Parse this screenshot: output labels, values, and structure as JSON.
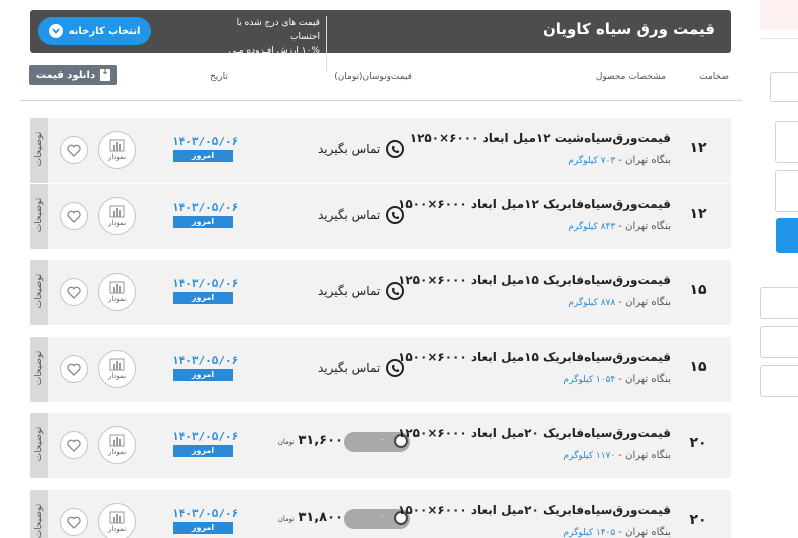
{
  "header": {
    "title": "قیمت ورق سیاه کاویان",
    "note_line1": "قیمت های درج شده با احتساب",
    "note_line2": "۱۰% ارزش افـزوده مـی بـاشـد.",
    "factory_button": "انتخاب کارخانه"
  },
  "table_header": {
    "thickness": "ضخامت",
    "specs": "مشخصات محصول",
    "price": "قیمت‌ونوسان(تومان)",
    "date": "تاریخ",
    "download_button": "دانلود قیمت"
  },
  "labels": {
    "description": "توضیحات",
    "chart": "نمودار",
    "today": "امروز",
    "contact": "تماس بگیرید",
    "currency": "تومان",
    "change_zero": "۰"
  },
  "rows": [
    {
      "thickness": "۱۲",
      "name": "قیمت‌ورق‌سیاه‌شیت ۱۲میل ابعاد ۶۰۰۰×۱۲۵۰",
      "warehouse": "بنگاه تهران - ",
      "weight": "۷۰۳ کیلوگرم",
      "date": "۱۴۰۳/۰۵/۰۶",
      "price": null
    },
    {
      "thickness": "۱۲",
      "name": "قیمت‌ورق‌سیاه‌فابریک ۱۲میل ابعاد ۶۰۰۰×۱۵۰۰",
      "warehouse": "بنگاه تهران - ",
      "weight": "۸۴۳ کیلوگرم",
      "date": "۱۴۰۳/۰۵/۰۶",
      "price": null
    },
    {
      "thickness": "۱۵",
      "name": "قیمت‌ورق‌سیاه‌فابریک ۱۵میل ابعاد ۶۰۰۰×۱۲۵۰",
      "warehouse": "بنگاه تهران - ",
      "weight": "۸۷۸ کیلوگرم",
      "date": "۱۴۰۳/۰۵/۰۶",
      "price": null
    },
    {
      "thickness": "۱۵",
      "name": "قیمت‌ورق‌سیاه‌فابریک ۱۵میل ابعاد ۶۰۰۰×۱۵۰۰",
      "warehouse": "بنگاه تهران - ",
      "weight": "۱۰۵۴ کیلوگرم",
      "date": "۱۴۰۳/۰۵/۰۶",
      "price": null
    },
    {
      "thickness": "۲۰",
      "name": "قیمت‌ورق‌سیاه‌فابریک ۲۰میل ابعاد ۶۰۰۰×۱۲۵۰",
      "warehouse": "بنگاه تهران - ",
      "weight": "۱۱۷۰ کیلوگرم",
      "date": "۱۴۰۳/۰۵/۰۶",
      "price": "۳۱,۶۰۰"
    },
    {
      "thickness": "۲۰",
      "name": "قیمت‌ورق‌سیاه‌فابریک ۲۰میل ابعاد ۶۰۰۰×۱۵۰۰",
      "warehouse": "بنگاه تهران - ",
      "weight": "۱۴۰۵ کیلوگرم",
      "date": "۱۴۰۳/۰۵/۰۶",
      "price": "۳۱,۸۰۰"
    }
  ]
}
